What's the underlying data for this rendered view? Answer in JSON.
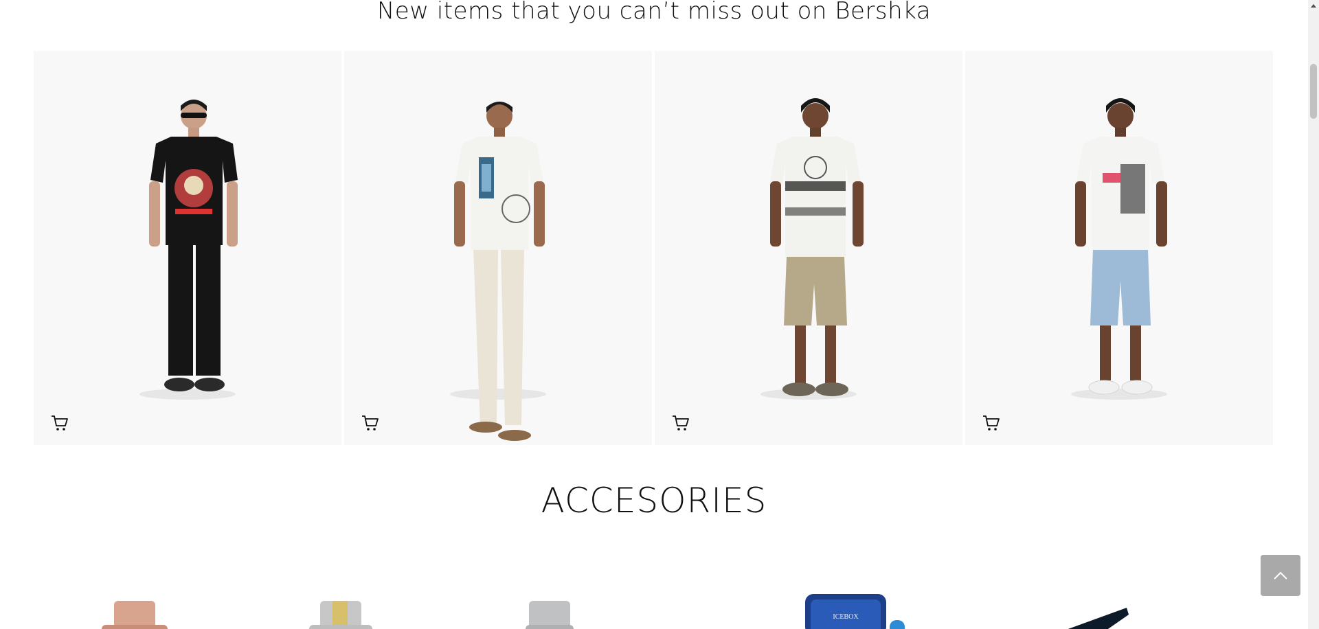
{
  "sections": {
    "new_items_title": "New items that you can’t miss out on Bershka",
    "accessories_title": "ACCESORIES"
  },
  "products": [
    {
      "name": "graphic-black-tee-outfit",
      "tshirt": "#151515",
      "print": "#c44",
      "trousers": "#151515",
      "shoes": "#2a2a2a"
    },
    {
      "name": "white-print-tee-cargo-outfit",
      "tshirt": "#f3f3f0",
      "print": "#3a6a8a",
      "trousers": "#e9e4d6",
      "shoes": "#8b6a4a"
    },
    {
      "name": "printed-shirt-cargo-shorts-outfit",
      "tshirt": "#f2f2ef",
      "print": "#222222",
      "trousers": "#b5a98a",
      "shoes": "#6d6558"
    },
    {
      "name": "white-tee-denim-shorts-outfit",
      "tshirt": "#f4f4f2",
      "print": "#e0526d",
      "trousers": "#9dbbd6",
      "shoes": "#f0f0f0"
    }
  ],
  "icons": {
    "cart": "cart-icon",
    "scroll_top": "chevron-up-icon"
  },
  "colors": {
    "card_bg": "#f8f8f8",
    "back_to_top_bg": "#a9a9a9",
    "text": "#111111"
  }
}
